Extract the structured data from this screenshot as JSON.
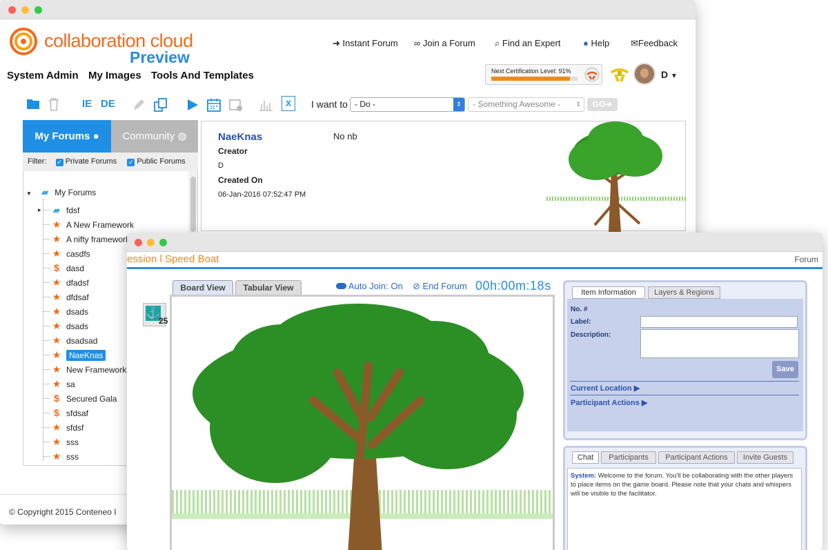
{
  "app": {
    "brand": "collaboration cloud",
    "brand_sub": "Preview"
  },
  "topnav": {
    "instant_forum": "Instant Forum",
    "join_forum": "Join a Forum",
    "find_expert": "Find an Expert",
    "help": "Help",
    "feedback": "Feedback",
    "user_initial": "D"
  },
  "mainnav": {
    "system_admin": "System Admin",
    "my_images": "My Images",
    "tools_templates": "Tools And Templates"
  },
  "certification": {
    "label": "Next Certification Level: 91%",
    "progress": 0.91
  },
  "toolbar": {
    "ie": "IE",
    "de": "DE",
    "excel": "X",
    "i_want_to": "I want to",
    "do_select": "- Do -",
    "something_select": "- Something Awesome -",
    "go": "GO"
  },
  "sidebar": {
    "tab_my": "My Forums",
    "tab_community": "Community",
    "filter_label": "Filter:",
    "private_forums": "Private Forums",
    "public_forums": "Public Forums",
    "root": "My Forums",
    "items": [
      {
        "label": "fdsf",
        "type": "folder"
      },
      {
        "label": "A New Framework",
        "type": "star"
      },
      {
        "label": "A nifty framework",
        "type": "star"
      },
      {
        "label": "casdfs",
        "type": "star"
      },
      {
        "label": "dasd",
        "type": "dollar"
      },
      {
        "label": "dfadsf",
        "type": "star"
      },
      {
        "label": "dfdsaf",
        "type": "star"
      },
      {
        "label": "dsads",
        "type": "star"
      },
      {
        "label": "dsads",
        "type": "star"
      },
      {
        "label": "dsadsad",
        "type": "star"
      },
      {
        "label": "NaeKnas",
        "type": "star",
        "selected": true
      },
      {
        "label": "New Framework",
        "type": "star"
      },
      {
        "label": "sa",
        "type": "star"
      },
      {
        "label": "Secured Gala",
        "type": "dollar"
      },
      {
        "label": "sfdsaf",
        "type": "dollar"
      },
      {
        "label": "sfdsf",
        "type": "star"
      },
      {
        "label": "sss",
        "type": "star"
      },
      {
        "label": "sss",
        "type": "star"
      }
    ]
  },
  "detail": {
    "name": "NaeKnas",
    "nb": "No nb",
    "creator_label": "Creator",
    "creator": "D",
    "created_on_label": "Created On",
    "created_on": "06-Jan-2016 07:52:47 PM"
  },
  "footer": {
    "copyright": "© Copyright 2015 Conteneo I"
  },
  "session": {
    "title": "ession l Speed Boat",
    "forum_link": "Forum",
    "board_view": "Board View",
    "tabular_view": "Tabular View",
    "auto_join": "Auto Join: On",
    "end_forum": "End Forum",
    "timer": "00h:00m:18s",
    "anchor_count": "25"
  },
  "item_panel": {
    "tab_info": "Item Information",
    "tab_layers": "Layers & Regions",
    "no_label": "No. #",
    "label_label": "Label:",
    "description_label": "Description:",
    "save": "Save",
    "current_location": "Current Location",
    "participant_actions": "Participant Actions"
  },
  "chat_panel": {
    "tab_chat": "Chat",
    "tab_participants": "Participants",
    "tab_actions": "Participant Actions",
    "tab_invite": "Invite Guests",
    "system_label": "System:",
    "system_message": "Welcome to the forum. You'll be collaborating with the other players to place items on the game board. Please note that your chats and whispers will be visible to the facilitator."
  },
  "colors": {
    "brand_orange": "#f26b1d",
    "accent_blue": "#1f8fe5",
    "community_gray": "#b8b8b8"
  }
}
